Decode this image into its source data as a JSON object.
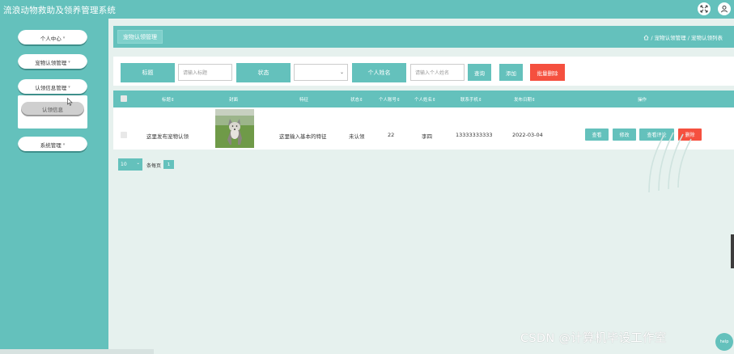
{
  "app": {
    "title": "流浪动物救助及领养管理系统",
    "expand_icon": "expand-icon",
    "user_icon": "user-icon"
  },
  "sidebar": {
    "items": [
      {
        "label": "个人中心",
        "caret": "▾"
      },
      {
        "label": "宠物认领管理",
        "caret": "▾"
      },
      {
        "label": "认领信息管理",
        "caret": "▾"
      },
      {
        "label": "系统管理",
        "caret": "▾"
      }
    ],
    "submenu": {
      "label": "认领信息"
    }
  },
  "breadcrumb": {
    "page_tag": "宠物认领管理",
    "path": "/ 宠物认领管理 / 宠物认领列表",
    "home_icon": "home-icon"
  },
  "search": {
    "title_label": "标题",
    "title_placeholder": "请输入标题",
    "status_label": "状态",
    "status_value": "",
    "name_label": "个人姓名",
    "name_placeholder": "请输入个人姓名",
    "query_btn": "查询",
    "add_btn": "添加",
    "batch_delete_btn": "批量删除"
  },
  "table": {
    "headers": [
      "标题",
      "封面",
      "特征",
      "状态",
      "个人账号",
      "个人姓名",
      "联系手机",
      "发布日期",
      "操作"
    ],
    "sort_mark": "⇕",
    "rows": [
      {
        "title": "这里发布宠物认领",
        "feature": "这里输入基本的特征",
        "status": "未认领",
        "account": "22",
        "name": "李四",
        "phone": "13333333333",
        "date": "2022-03-04",
        "actions": [
          "查看",
          "修改",
          "查看评论",
          "删除"
        ]
      }
    ]
  },
  "pagination": {
    "page_size": "10",
    "per_page_label": "条每页",
    "current_page": "1"
  },
  "watermark": "CSDN @计算机毕设工作室",
  "help_label": "help",
  "colors": {
    "accent": "#64c1bc",
    "danger": "#f5503f",
    "background": "#e6f1ee"
  }
}
